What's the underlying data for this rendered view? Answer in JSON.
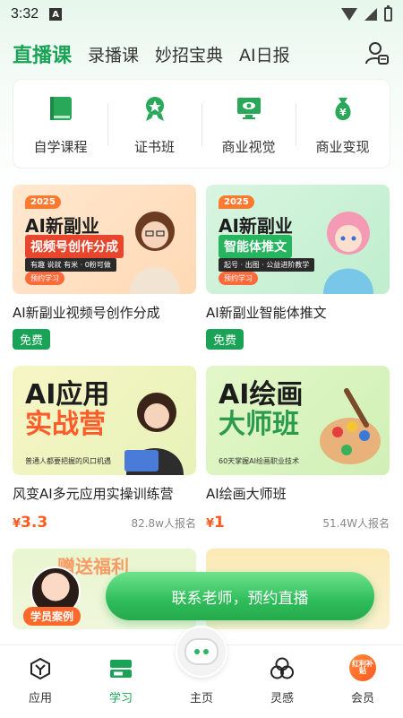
{
  "status": {
    "time": "3:32",
    "indicator": "A"
  },
  "tabs": [
    {
      "label": "直播课",
      "active": true
    },
    {
      "label": "录播课",
      "active": false
    },
    {
      "label": "妙招宝典",
      "active": false
    },
    {
      "label": "AI日报",
      "active": false
    }
  ],
  "categories": [
    {
      "label": "自学课程",
      "icon": "book-icon"
    },
    {
      "label": "证书班",
      "icon": "certificate-icon"
    },
    {
      "label": "商业视觉",
      "icon": "monitor-eye-icon"
    },
    {
      "label": "商业变现",
      "icon": "money-bag-icon"
    }
  ],
  "courses": [
    {
      "badge": "2025",
      "thumb_title": "AI新副业",
      "thumb_sub": "视频号创作分成",
      "thumb_strip": "有趣 说就 有米 · 0粉可做",
      "thumb_btn": "预约学习",
      "title": "AI新副业视频号创作分成",
      "tag": "免费"
    },
    {
      "badge": "2025",
      "thumb_title": "AI新副业",
      "thumb_sub": "智能体推文",
      "thumb_strip": "起号 · 出图 · 公益进阶教学",
      "thumb_btn": "预约学习",
      "title": "AI新副业智能体推文",
      "tag": "免费"
    },
    {
      "thumb_line1": "AI应用",
      "thumb_line2": "实战营",
      "thumb_foot": "普通人都要把握的风口机遇",
      "title": "风变AI多元应用实操训练营",
      "price_currency": "¥",
      "price": "3.3",
      "enrolled": "82.8w人报名"
    },
    {
      "thumb_line1": "AI绘画",
      "thumb_line2": "大师班",
      "thumb_foot": "60天掌握AI绘画职业技术",
      "title": "AI绘画大师班",
      "price_currency": "¥",
      "price": "1",
      "enrolled": "51.4W人报名"
    }
  ],
  "partial_left": "赠送福利",
  "student_case": "学员案例",
  "cta": "联系老师，预约直播",
  "nav": [
    {
      "label": "应用",
      "icon": "app-cube-icon"
    },
    {
      "label": "学习",
      "icon": "study-icon",
      "active": true
    },
    {
      "label": "主页",
      "icon": "robot-icon"
    },
    {
      "label": "灵感",
      "icon": "inspiration-icon"
    },
    {
      "label": "会员",
      "icon": "member-badge-icon",
      "badge_text": "红利补贴"
    }
  ]
}
